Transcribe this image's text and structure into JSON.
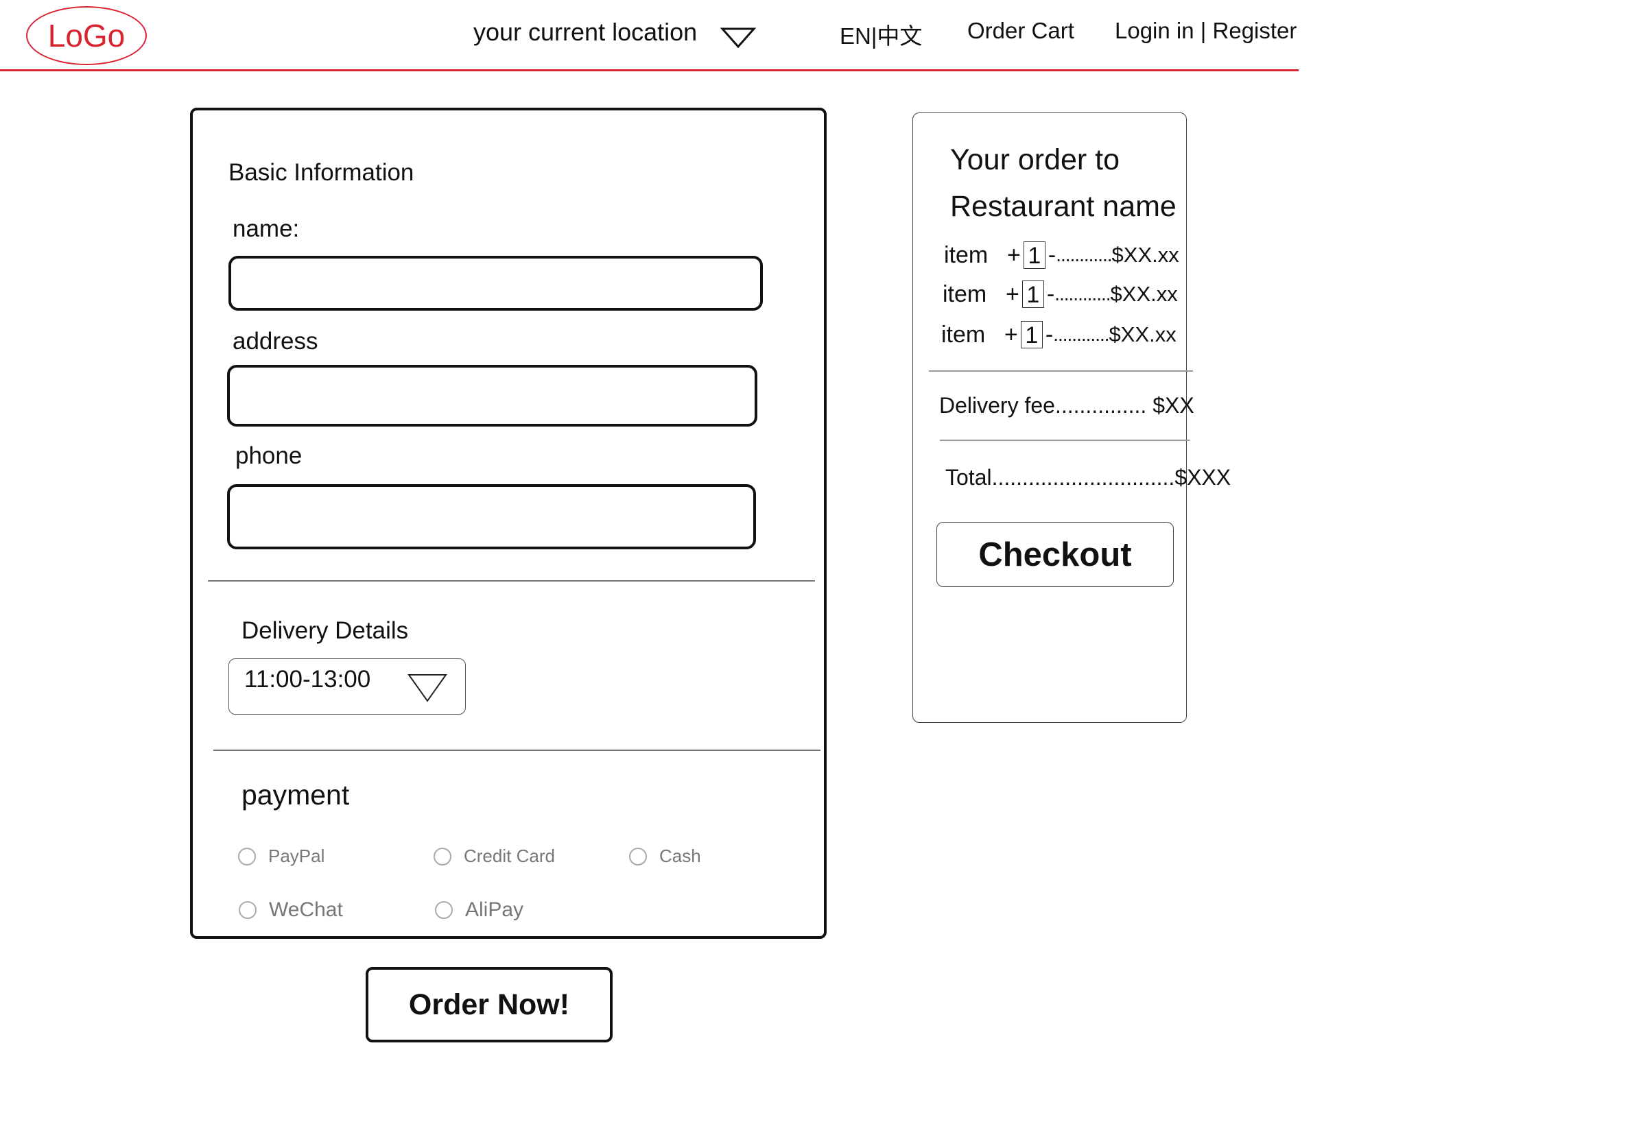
{
  "header": {
    "logo_text": "LoGo",
    "location_label": "your current location",
    "language": "EN|中文",
    "order_cart": "Order Cart",
    "login_register": "Login in | Register",
    "accent_color": "#d9232f"
  },
  "form": {
    "basic_information_title": "Basic Information",
    "fields": [
      {
        "label": "name:",
        "value": ""
      },
      {
        "label": "address",
        "value": ""
      },
      {
        "label": "phone",
        "value": ""
      }
    ],
    "delivery_details_title": "Delivery Details",
    "delivery_time": "11:00-13:00",
    "payment_title": "payment",
    "payment_options": [
      "PayPal",
      "Credit Card",
      "Cash",
      "WeChat",
      "AliPay"
    ],
    "order_button": "Order Now!"
  },
  "summary": {
    "title_line1": "Your order to",
    "title_line2": "Restaurant name",
    "items": [
      {
        "name": "item",
        "plus": "+",
        "qty": "1",
        "minus": "-",
        "dots": "............",
        "price": "$XX.xx"
      },
      {
        "name": "item",
        "plus": "+",
        "qty": "1",
        "minus": "-",
        "dots": "............",
        "price": "$XX.xx"
      },
      {
        "name": "item",
        "plus": "+",
        "qty": "1",
        "minus": "-",
        "dots": "............",
        "price": "$XX.xx"
      }
    ],
    "delivery_fee_label": "Delivery fee...............",
    "delivery_fee_value": "$XX",
    "total_label": "Total..............................",
    "total_value": "$XXX",
    "checkout_button": "Checkout"
  }
}
